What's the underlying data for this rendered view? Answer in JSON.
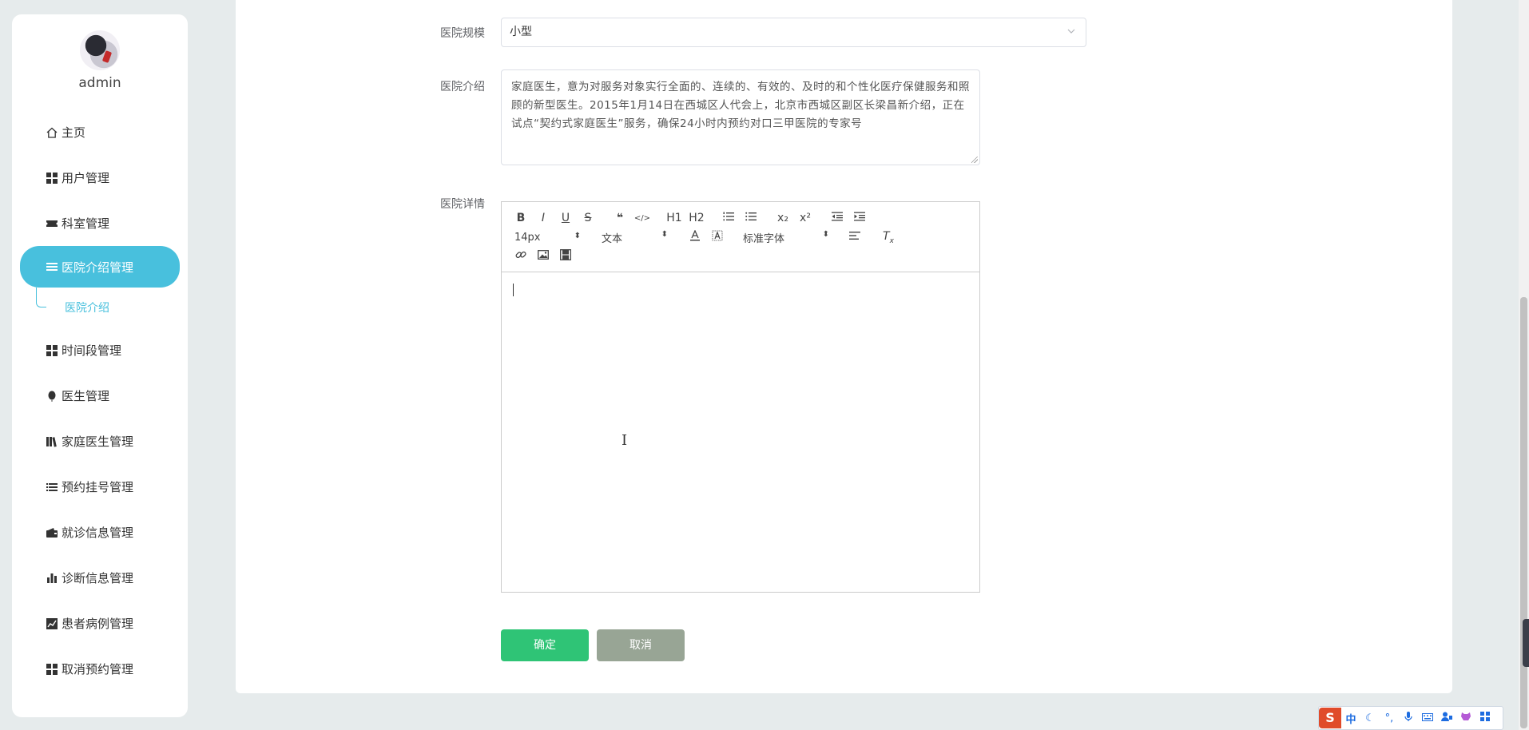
{
  "sidebar": {
    "username": "admin",
    "menu": [
      {
        "label": "主页",
        "icon": "home-icon"
      },
      {
        "label": "用户管理",
        "icon": "grid-icon"
      },
      {
        "label": "科室管理",
        "icon": "ticket-icon"
      },
      {
        "label": "医院介绍管理",
        "icon": "list-icon",
        "active": true
      },
      {
        "label": "时间段管理",
        "icon": "grid-icon"
      },
      {
        "label": "医生管理",
        "icon": "balloon-icon"
      },
      {
        "label": "家庭医生管理",
        "icon": "books-icon"
      },
      {
        "label": "预约挂号管理",
        "icon": "list-icon"
      },
      {
        "label": "就诊信息管理",
        "icon": "wallet-icon"
      },
      {
        "label": "诊断信息管理",
        "icon": "bar-chart-icon"
      },
      {
        "label": "患者病例管理",
        "icon": "line-chart-icon"
      },
      {
        "label": "取消预约管理",
        "icon": "grid-icon"
      }
    ],
    "submenu": {
      "label": "医院介绍"
    }
  },
  "form": {
    "scale_label": "医院规模",
    "scale_value": "小型",
    "intro_label": "医院介绍",
    "intro_value": "家庭医生，意为对服务对象实行全面的、连续的、有效的、及时的和个性化医疗保健服务和照顾的新型医生。2015年1月14日在西城区人代会上，北京市西城区副区长梁昌新介绍，正在试点“契约式家庭医生”服务，确保24小时内预约对口三甲医院的专家号",
    "detail_label": "医院详情",
    "ok_label": "确定",
    "cancel_label": "取消"
  },
  "editor": {
    "font_size": "14px",
    "header_select": "文本",
    "font_family": "标准字体",
    "buttons_row1": [
      "B",
      "I",
      "U",
      "S",
      "❝",
      "</>",
      "H1",
      "H2",
      "OL",
      "UL",
      "x₂",
      "x²",
      "outdent",
      "indent"
    ],
    "content": ""
  },
  "ime": {
    "logo": "S",
    "mode": "中"
  },
  "colors": {
    "accent": "#48c0dd",
    "ok": "#2fc476",
    "cancel": "#98a595",
    "bg": "#e6ebec"
  }
}
